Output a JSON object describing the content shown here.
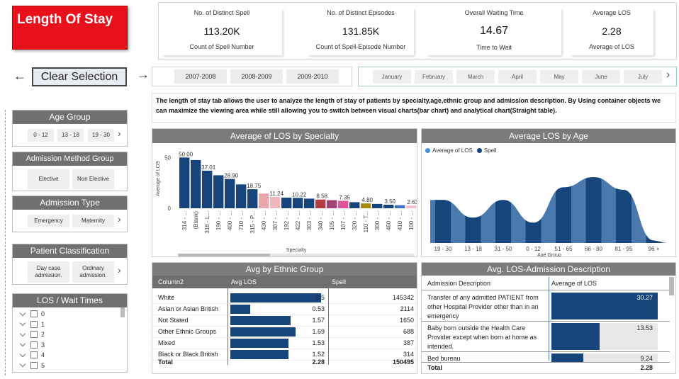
{
  "title": "Length Of  Stay",
  "kpis": [
    {
      "title": "No. of Distinct Spell",
      "value": "113.20K",
      "sub": "Count of Spell Number"
    },
    {
      "title": "No. of Distinct Episodes",
      "value": "131.85K",
      "sub": "Count of Spell-Episode Number"
    },
    {
      "title": "Overall Waiting Time",
      "value": "14.67",
      "sub": "Time to Wait"
    },
    {
      "title": "Average LOS",
      "value": "2.28",
      "sub": "Average of LOS"
    }
  ],
  "nav": {
    "back_icon": "←",
    "forward_icon": "→",
    "clear_label": "Clear Selection"
  },
  "years": [
    "2007-2008",
    "2008-2009",
    "2009-2010"
  ],
  "months": [
    "January",
    "February",
    "March",
    "April",
    "May",
    "June",
    "July"
  ],
  "months_next_icon": "›",
  "description": "The length of stay tab allows the user to analyze the length of stay of patients by specialty,age,ethnic group and admission description. By Using container objects we can maximize the viewing area while still allowing you to switch between visual charts(bar chart) and analytical chart(Straight table).",
  "slicers": {
    "age_group": {
      "title": "Age Group",
      "options": [
        "0 - 12",
        "13 - 18",
        "19 - 30"
      ]
    },
    "admission_method": {
      "title": "Admission Method Group",
      "options": [
        "Elective",
        "Non Elective"
      ]
    },
    "admission_type": {
      "title": "Admission Type",
      "options": [
        "Emergency",
        "Maternity"
      ]
    },
    "patient_class": {
      "title": "Patient Classification",
      "options": [
        "Day case admission.",
        "Ordinary admission."
      ]
    },
    "los_wait": {
      "title": "LOS / Wait Times",
      "options": [
        "0",
        "1",
        "2",
        "3",
        "4",
        "5"
      ]
    }
  },
  "chevron": "›",
  "specialty_panel": {
    "title": "Average of LOS by Specialty"
  },
  "age_panel": {
    "title": "Average LOS by Age"
  },
  "ethnic_panel": {
    "title": "Avg by Ethnic Group",
    "columns": [
      "Column2",
      "Avg LOS",
      "Spell"
    ],
    "rows": [
      {
        "name": "White",
        "avg": "2.5",
        "spell": "145342"
      },
      {
        "name": "Asian or Asian British",
        "avg": "0.53",
        "spell": "2114"
      },
      {
        "name": "Not Stated",
        "avg": "1.57",
        "spell": "1650"
      },
      {
        "name": "Other Ethnic Groups",
        "avg": "1.69",
        "spell": "688"
      },
      {
        "name": "Mixed",
        "avg": "1.53",
        "spell": "387"
      },
      {
        "name": "Black or Black British",
        "avg": "1.52",
        "spell": "314"
      }
    ],
    "total": {
      "label": "Total",
      "avg": "2.28",
      "spell": "150495"
    },
    "bar_fractions": [
      0.95,
      0.21,
      0.63,
      0.68,
      0.61,
      0.61
    ]
  },
  "admission_panel": {
    "title": "Avg. LOS-Admission Description",
    "columns": [
      "Admission Description",
      "Average of LOS"
    ],
    "rows": [
      {
        "desc": "Transfer of any admitted PATIENT from other Hospital Provider other than in an emergency",
        "avg": "30.27"
      },
      {
        "desc": "Baby born outside the Health Care Provider except when born at home as intended.",
        "avg": "13.53"
      },
      {
        "desc": "Bed bureau",
        "avg": "9.24"
      }
    ],
    "total": {
      "label": "Total",
      "avg": "2.28"
    },
    "bar_fractions": [
      1.0,
      0.45,
      0.3
    ]
  },
  "chart_data": [
    {
      "type": "bar",
      "title": "Average of LOS by Specialty",
      "xlabel": "Specialty",
      "ylabel": "Average of LOS",
      "ylim": [
        0,
        60
      ],
      "yticks": [
        0,
        50
      ],
      "categories": [
        "314 - ...",
        "(Blank)",
        "318 - L...",
        "190 - ...",
        "400 - ...",
        "710 - ...",
        "315 - P...",
        "430 - ...",
        "307 - ...",
        "192 - ...",
        "422 - ...",
        "303 - ...",
        "340 - ...",
        "105 - ...",
        "107 - ...",
        "320 - ...",
        "110 - T...",
        "300 - ...",
        "460 - ...",
        "410 - ...",
        "100 - ..."
      ],
      "values": [
        50.0,
        47.5,
        37.01,
        32.5,
        28.9,
        23.5,
        18.75,
        14.5,
        11.24,
        10.5,
        10.22,
        9.5,
        8.58,
        8.0,
        7.35,
        6.0,
        4.8,
        4.3,
        3.5,
        3.0,
        2.63
      ],
      "labels": [
        "50.00",
        "",
        "37.01",
        "",
        "28.90",
        "",
        "18.75",
        "",
        "11.24",
        "",
        "10.22",
        "",
        "8.58",
        "",
        "7.35",
        "",
        "4.80",
        "",
        "3.50",
        "",
        "2.63"
      ],
      "colors": [
        "#16457c",
        "#16457c",
        "#16457c",
        "#16457c",
        "#16457c",
        "#16457c",
        "#16457c",
        "#e8a7ab",
        "#f1b5bb",
        "#16457c",
        "#16457c",
        "#16457c",
        "#b53a48",
        "#a8417a",
        "#e05599",
        "#16457c",
        "#a58a12",
        "#16457c",
        "#16457c",
        "#3e6fbf",
        "#f3c1cc"
      ]
    },
    {
      "type": "area",
      "title": "Average LOS by Age",
      "xlabel": "Age Group",
      "series": [
        {
          "name": "Average of LOS"
        },
        {
          "name": "Spell"
        }
      ],
      "categories": [
        "19 - 30",
        "13 - 18",
        "31 - 50",
        "0 - 12",
        "51 - 65",
        "66 - 80",
        "81 - 95",
        "96 +"
      ],
      "values": [
        1.7,
        1.0,
        1.7,
        0.8,
        2.2,
        2.6,
        2.1,
        0.1
      ],
      "colors": {
        "avg": "#4a79ad",
        "spell": "#16457c"
      }
    }
  ]
}
